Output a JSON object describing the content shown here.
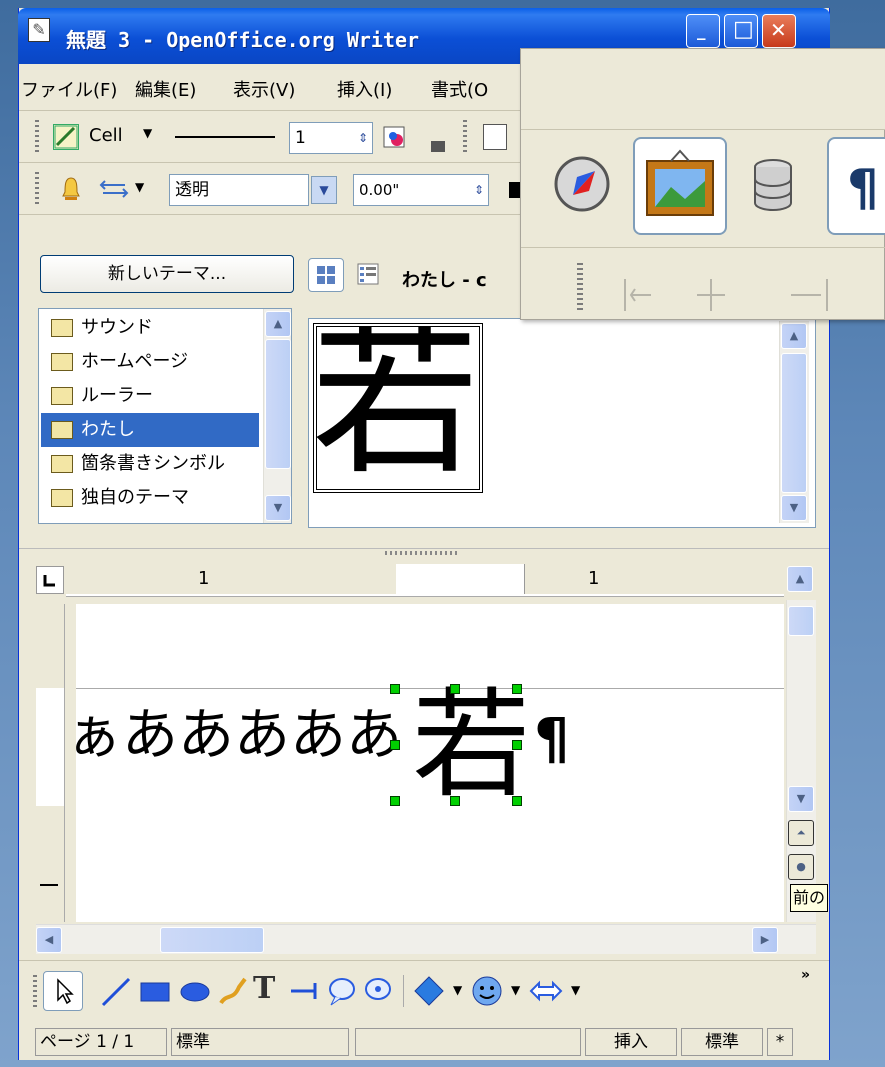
{
  "window": {
    "title": "無題 3 - OpenOffice.org Writer",
    "minimize_glyph": "_",
    "maximize_glyph": "□",
    "close_glyph": "✕"
  },
  "menu": {
    "items": [
      "ファイル(F)",
      "編集(E)",
      "表示(V)",
      "挿入(I)",
      "書式(O"
    ]
  },
  "toolbar1": {
    "cell_label": "Cell",
    "line_width": "1"
  },
  "toolbar2": {
    "transparency": "透明",
    "offset": "0.00\""
  },
  "gallery": {
    "new_theme_label": "新しいテーマ...",
    "theme_title": "わたし - c",
    "themes": [
      {
        "label": "サウンド",
        "selected": false
      },
      {
        "label": "ホームページ",
        "selected": false
      },
      {
        "label": "ルーラー",
        "selected": false
      },
      {
        "label": "わたし",
        "selected": true
      },
      {
        "label": "箇条書きシンボル",
        "selected": false
      },
      {
        "label": "独自のテーマ",
        "selected": false
      }
    ],
    "preview_glyph": "若"
  },
  "ruler": {
    "labels": [
      "1",
      "1"
    ]
  },
  "document": {
    "text": "ぁあああああ",
    "image_glyph": "若",
    "paragraph_mark": "¶"
  },
  "tooltip": {
    "text": "前の"
  },
  "statusbar": {
    "page": "ページ 1 / 1",
    "style": "標準",
    "insert_mode": "挿入",
    "selection_mode": "標準",
    "modified": "*"
  },
  "colors": {
    "titlebar": "#0a46c4",
    "selection": "#316ac5",
    "handle": "#00d000"
  }
}
